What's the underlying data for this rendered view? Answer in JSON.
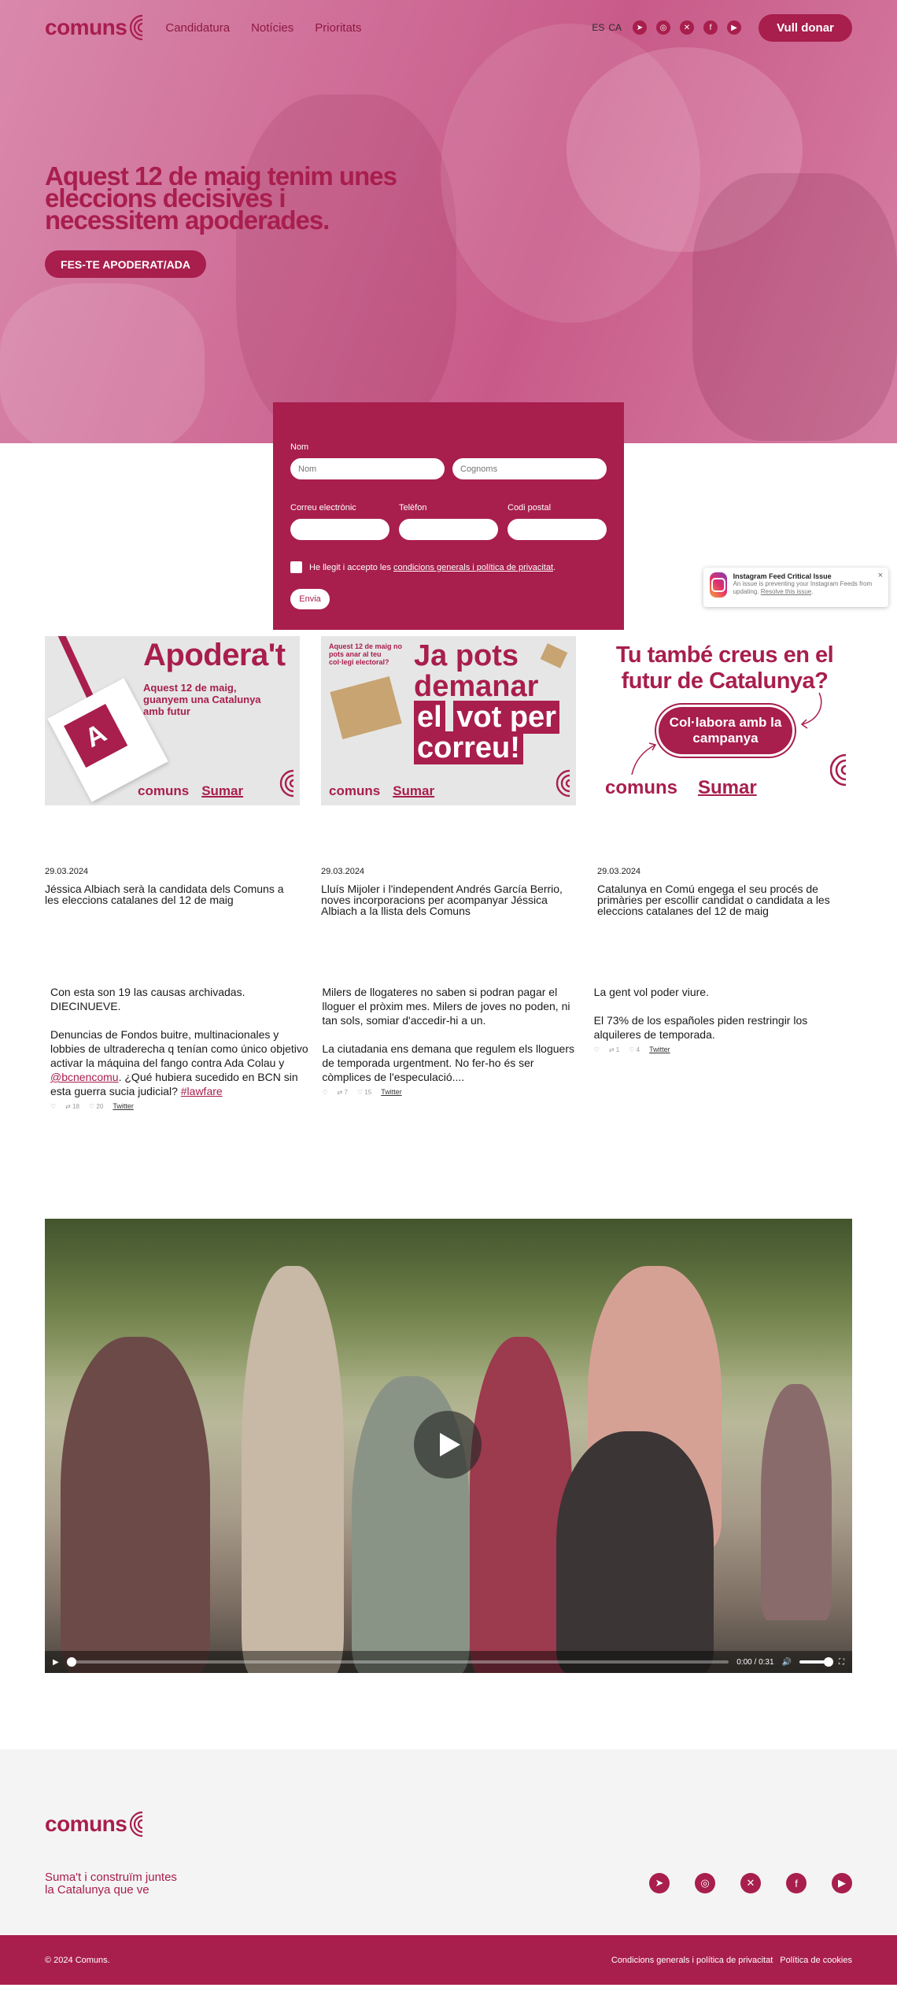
{
  "header": {
    "logo_text": "comuns",
    "nav": [
      "Candidatura",
      "Notícies",
      "Prioritats"
    ],
    "languages": [
      "ES",
      "CA"
    ],
    "social_icons": [
      "telegram-icon",
      "instagram-icon",
      "x-icon",
      "facebook-icon",
      "youtube-icon"
    ],
    "donate_label": "Vull donar"
  },
  "hero": {
    "title": "Aquest 12 de maig tenim unes eleccions decisives i necessitem apoderades.",
    "cta_label": "FES-TE APODERAT/ADA"
  },
  "form": {
    "nom_label": "Nom",
    "nom_placeholder": "Nom",
    "cognoms_placeholder": "Cognoms",
    "email_label": "Correu electrònic",
    "phone_label": "Telèfon",
    "postal_label": "Codi postal",
    "consent_prefix": "He llegit i accepto les ",
    "consent_link": "condicions generals i política de privacitat",
    "consent_suffix": ".",
    "submit_label": "Envia"
  },
  "instagram_notice": {
    "title": "Instagram Feed Critical Issue",
    "text": "An issue is preventing your Instagram Feeds from updating.",
    "link": "Resolve this issue",
    "close": "×"
  },
  "banners": [
    {
      "title": "Apodera't",
      "subtitle": "Aquest 12 de maig, guanyem una Catalunya amb futur",
      "badge_letter": "A",
      "brand1": "comuns",
      "brand2": "Sumar"
    },
    {
      "small": "Aquest 12 de maig no pots anar al teu col·legi electoral?",
      "line1": "Ja pots",
      "line2": "demanar",
      "line3a": "el",
      "line3b": "vot per",
      "line4": "correu!",
      "brand1": "comuns",
      "brand2": "Sumar"
    },
    {
      "title": "Tu també creus en el futur de Catalunya?",
      "pill": "Col·labora amb la campanya",
      "brand1": "comuns",
      "brand2": "Sumar"
    }
  ],
  "news": [
    {
      "date": "29.03.2024",
      "title": "Jéssica Albiach serà la candidata dels Comuns a les eleccions catalanes del 12 de maig"
    },
    {
      "date": "29.03.2024",
      "title": "Lluís Mijoler i l'independent Andrés García Berrio, noves incorporacions per acompanyar Jéssica Albiach a la llista dels Comuns"
    },
    {
      "date": "29.03.2024",
      "title": "Catalunya en Comú engega el seu procés de primàries per escollir candidat o candidata a les eleccions catalanes del 12 de maig"
    }
  ],
  "tweets": [
    {
      "text_a": "Con esta son 19 las causas archivadas. DIECINUEVE.\n\nDenuncias de Fondos buitre, multinacionales y lobbies de ultraderecha q tenían como único objetivo activar la máquina del fango contra Ada Colau y ",
      "mention": "@bcnencomu",
      "text_b": ". ¿Qué hubiera sucedido en BCN sin esta guerra sucia judicial? ",
      "hashtag": "#lawfare",
      "retweets": "18",
      "likes": "20",
      "source": "Twitter"
    },
    {
      "text_a": "Milers de llogateres no saben si podran pagar el lloguer el pròxim mes. Milers de joves no poden, ni tan sols, somiar d'accedir-hi a un.\n\nLa ciutadania ens demana que regulem els lloguers de temporada urgentment. No fer-ho és ser còmplices de l'especulació....",
      "retweets": "7",
      "likes": "15",
      "source": "Twitter"
    },
    {
      "text_a": "La gent vol poder viure.\n\nEl 73% de los españoles piden restringir los alquileres de temporada.",
      "retweets": "1",
      "likes": "4",
      "source": "Twitter"
    }
  ],
  "video": {
    "current_time": "0:00",
    "duration": "0:31",
    "progress": 0.0,
    "volume": 1.0
  },
  "footer": {
    "logo_text": "comuns",
    "tagline_1": "Suma't i construïm juntes",
    "tagline_2": "la Catalunya que ve",
    "social_icons": [
      "telegram-icon",
      "instagram-icon",
      "x-icon",
      "facebook-icon",
      "youtube-icon"
    ],
    "copyright": "© 2024 Comuns.",
    "link_privacy": "Condicions generals i política de privacitat",
    "link_cookies": "Política de cookies"
  },
  "colors": {
    "brand": "#a81e4d",
    "hero_tint": "#d27aa0",
    "footer_bg": "#f4f4f4"
  }
}
